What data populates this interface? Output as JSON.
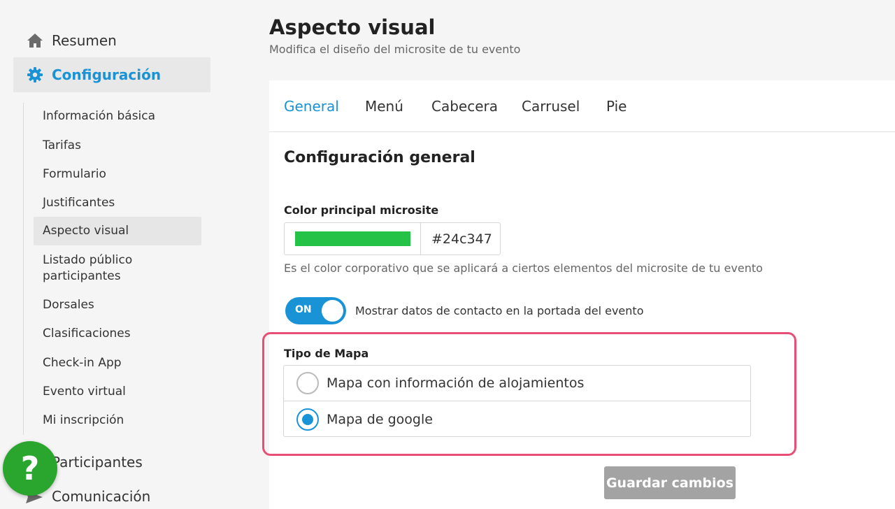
{
  "sidebar": {
    "resumen": {
      "label": "Resumen",
      "icon": "home-icon"
    },
    "configuracion": {
      "label": "Configuración",
      "icon": "gear-icon"
    },
    "sub_items": [
      "Información básica",
      "Tarifas",
      "Formulario",
      "Justificantes",
      "Aspecto visual",
      "Listado público participantes",
      "Dorsales",
      "Clasificaciones",
      "Check-in App",
      "Evento virtual",
      "Mi inscripción"
    ],
    "participantes": "Participantes",
    "comunicacion": "Comunicación",
    "help_label": "?"
  },
  "page": {
    "title": "Aspecto visual",
    "subtitle": "Modifica el diseño del microsite de tu evento"
  },
  "tabs": [
    "General",
    "Menú",
    "Cabecera",
    "Carrusel",
    "Pie"
  ],
  "section_title": "Configuración general",
  "color": {
    "label": "Color principal microsite",
    "value": "#24c347",
    "help": "Es el color corporativo que se aplicará a ciertos elementos del microsite de tu evento"
  },
  "toggle": {
    "state": "ON",
    "label": "Mostrar datos de contacto en la portada del evento"
  },
  "map": {
    "label": "Tipo de Mapa",
    "options": [
      "Mapa con información de alojamientos",
      "Mapa de google"
    ],
    "selected": "Mapa de google"
  },
  "save_label": "Guardar cambios",
  "colors": {
    "accent": "#1a93d6",
    "help_button": "#2aa52e",
    "highlight_border": "#e94f76",
    "disabled_button": "#a3a3a3"
  }
}
